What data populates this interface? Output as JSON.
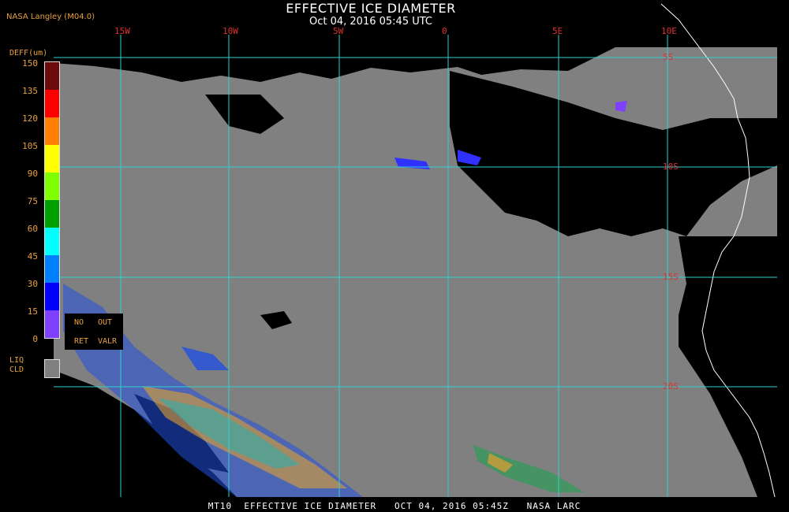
{
  "title": "EFFECTIVE ICE DIAMETER",
  "timestamp": "Oct 04, 2016 05:45 UTC",
  "credit": "NASA Langley (M04.0)",
  "footer": "MT10  EFFECTIVE ICE DIAMETER   OCT 04, 2016 05:45Z   NASA LARC",
  "legend": {
    "unit_label": "DEFF(um)",
    "ticks": [
      "150",
      "135",
      "120",
      "105",
      "90",
      "75",
      "60",
      "45",
      "30",
      "15",
      "0"
    ],
    "colors": [
      "#6b0b0b",
      "#ff0000",
      "#ff8000",
      "#ffff00",
      "#80ff00",
      "#00a000",
      "#00ffff",
      "#0080ff",
      "#0000ff",
      "#8040ff"
    ],
    "no_ret": "NO",
    "ret": "RET",
    "out": "OUT",
    "valr": "VALR",
    "liq_label_1": "LIQ",
    "liq_label_2": "CLD",
    "liq_color": "#808080"
  },
  "grid": {
    "longitudes": [
      "15W",
      "10W",
      "5W",
      "0",
      "5E",
      "10E"
    ],
    "latitudes": [
      "5S",
      "10S",
      "15S",
      "20S"
    ],
    "grid_color": "#30d0d0",
    "label_color": "#e03030"
  },
  "colors": {
    "ocean_cloud": "#808080",
    "clear": "#000000",
    "coast": "#ffffff"
  }
}
